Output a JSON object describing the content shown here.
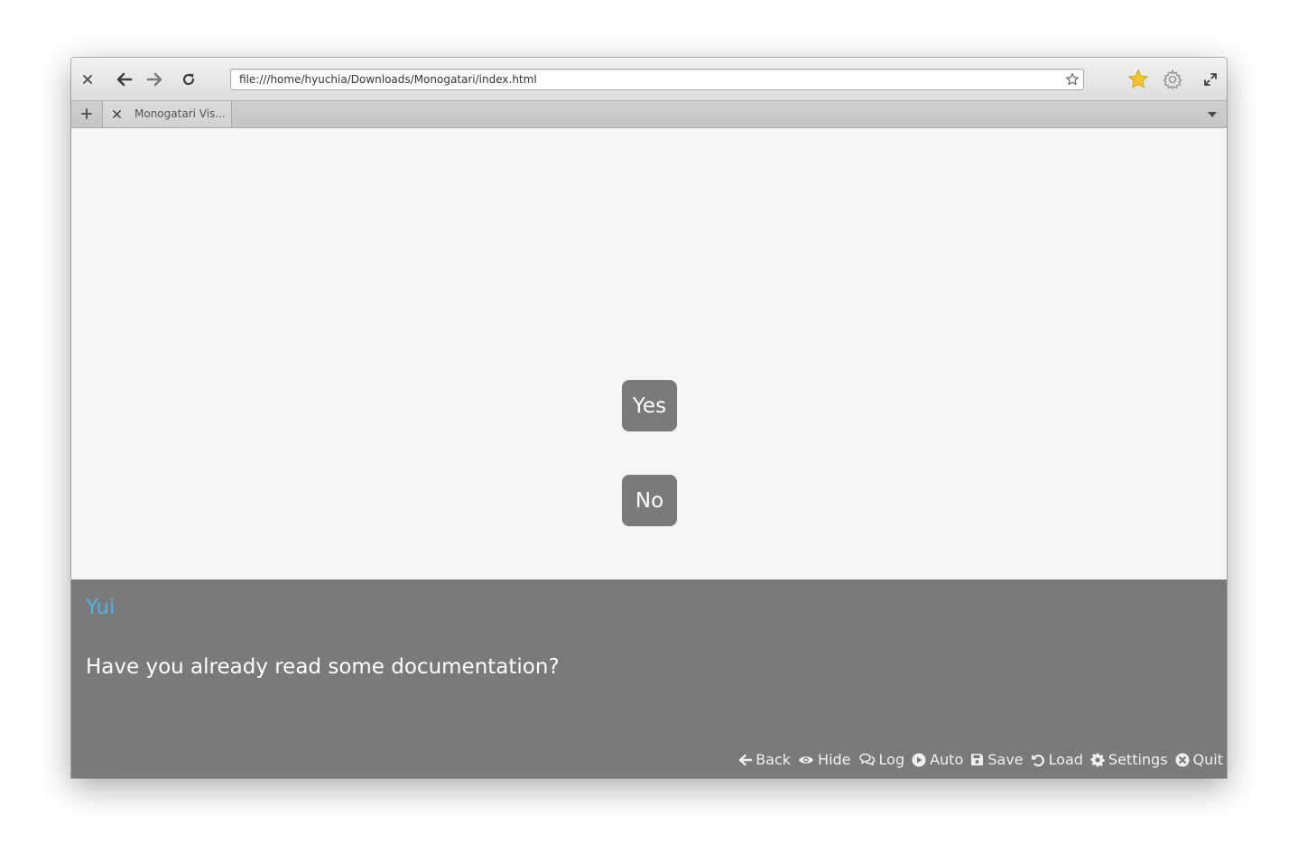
{
  "browser": {
    "url": "file:///home/hyuchia/Downloads/Monogatari/index.html",
    "tabs": [
      {
        "title": "Monogatari Vis..."
      }
    ]
  },
  "game": {
    "choices": [
      {
        "label": "Yes"
      },
      {
        "label": "No"
      }
    ],
    "speaker": "Yui",
    "speaker_color": "#4fb3e6",
    "dialog": "Have you already read some documentation?",
    "quick_menu": [
      {
        "label": "Back",
        "icon": "arrow-left-icon"
      },
      {
        "label": "Hide",
        "icon": "eye-icon"
      },
      {
        "label": "Log",
        "icon": "comments-icon"
      },
      {
        "label": "Auto",
        "icon": "play-circle-icon"
      },
      {
        "label": "Save",
        "icon": "floppy-icon"
      },
      {
        "label": "Load",
        "icon": "undo-icon"
      },
      {
        "label": "Settings",
        "icon": "gear-icon"
      },
      {
        "label": "Quit",
        "icon": "close-circle-icon"
      }
    ]
  }
}
